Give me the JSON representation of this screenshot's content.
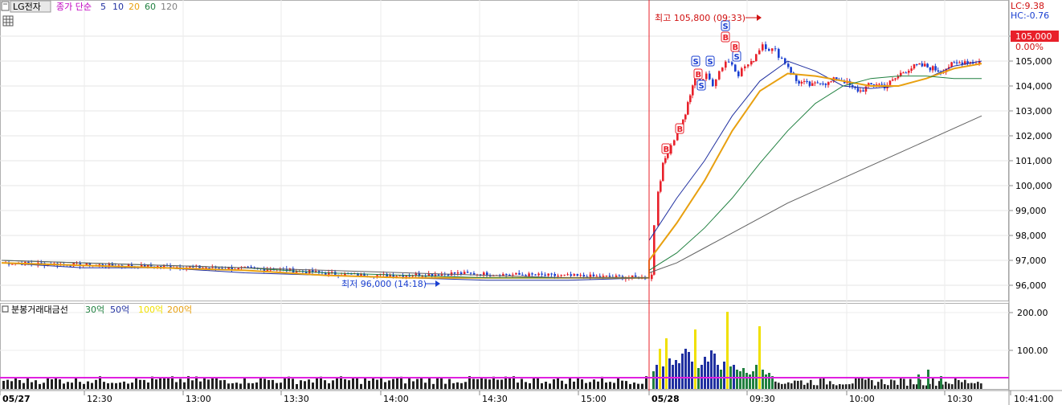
{
  "stock_name": "LG전자",
  "indicator_prefix": "종가 단순",
  "ma_periods": [
    "5",
    "10",
    "20",
    "60",
    "120"
  ],
  "high_annotation": "최고 105,800 (09:33)",
  "low_annotation": "최저 96,000 (14:18)",
  "lc_label": "LC:9.38",
  "hc_label": "HC:-0.76",
  "current_price_label": "105,000",
  "current_change_label": "0.00%",
  "volume_panel_title": "분봉거래대금선",
  "volume_levels": [
    "30억",
    "50억",
    "100억",
    "200억"
  ],
  "time_ticks": [
    "05/27",
    "12:30",
    "13:00",
    "13:30",
    "14:00",
    "14:30",
    "15:00",
    "05/28",
    "09:30",
    "10:00",
    "10:30",
    "10:41:00"
  ],
  "colors": {
    "up": "#e8202a",
    "down": "#1a3fd0",
    "ma5": "#2030a0",
    "ma20": "#e8a010",
    "ma60": "#208040",
    "ma120": "#606060",
    "magenta": "#e020e0"
  },
  "chart_data": {
    "type": "candlestick",
    "title": "LG전자",
    "price_axis_ticks": [
      "106,000",
      "105,000",
      "104,000",
      "103,000",
      "102,000",
      "101,000",
      "100,000",
      "99,000",
      "98,000",
      "97,000",
      "96,000"
    ],
    "price_ylim": [
      95700,
      106200
    ],
    "volume_axis_ticks": [
      "200.00",
      "100.00"
    ],
    "session_break": "05/28",
    "day1_start_price": 96900,
    "day1_low": 96000,
    "day1_close": 96300,
    "day2_high": 105800,
    "day2_close": 105000,
    "series": [
      {
        "name": "5",
        "trend": [
          96900,
          96700,
          96700,
          96500,
          96400,
          96300,
          96200,
          96200,
          96300,
          97800,
          99500,
          101000,
          102800,
          104200,
          105000,
          104600,
          104000,
          103900,
          104000,
          104300,
          104800,
          105000
        ]
      },
      {
        "name": "20",
        "trend": [
          96900,
          96800,
          96700,
          96600,
          96400,
          96300,
          96300,
          96300,
          96300,
          97000,
          98500,
          100200,
          102200,
          103800,
          104500,
          104400,
          104200,
          104000,
          104000,
          104300,
          104700,
          104900
        ]
      },
      {
        "name": "60",
        "trend": [
          97000,
          96900,
          96800,
          96700,
          96500,
          96400,
          96300,
          96300,
          96300,
          96600,
          97300,
          98300,
          99500,
          100900,
          102200,
          103300,
          104000,
          104300,
          104400,
          104400,
          104300,
          104300
        ]
      },
      {
        "name": "120",
        "trend": [
          97000,
          96900,
          96800,
          96700,
          96600,
          96500,
          96400,
          96300,
          96300,
          96500,
          96900,
          97500,
          98100,
          98700,
          99300,
          99800,
          100300,
          100800,
          101300,
          101800,
          102300,
          102800
        ]
      }
    ]
  }
}
